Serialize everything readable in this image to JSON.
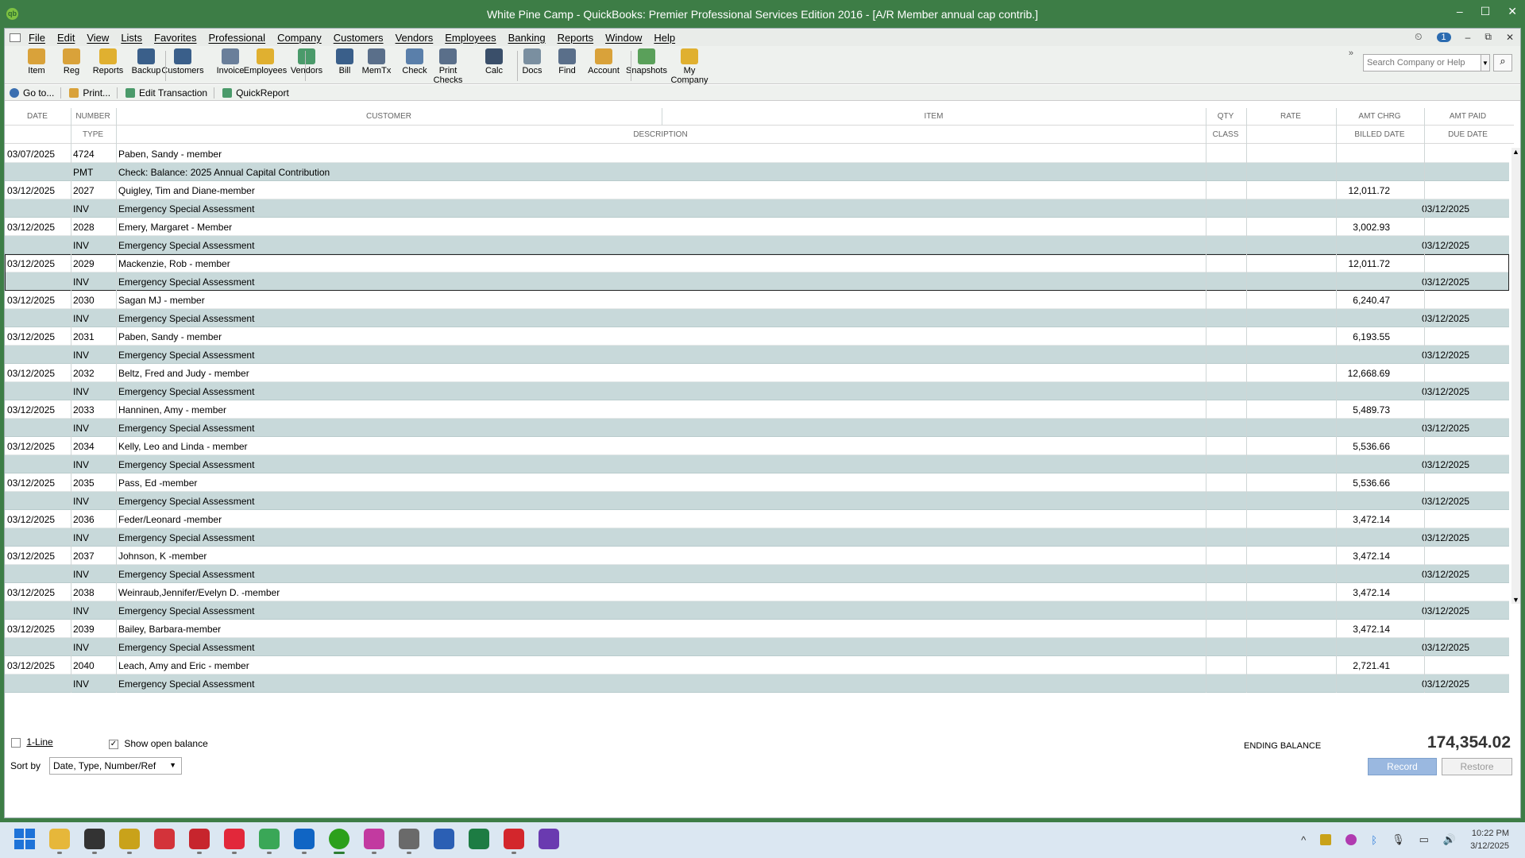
{
  "window": {
    "title": "White Pine Camp  - QuickBooks: Premier Professional Services Edition 2016 - [A/R Member annual cap contrib.]",
    "app_icon": "qb",
    "controls": [
      "–",
      "☐",
      "✕"
    ]
  },
  "menu": {
    "items": [
      "File",
      "Edit",
      "View",
      "Lists",
      "Favorites",
      "Professional",
      "Company",
      "Customers",
      "Vendors",
      "Employees",
      "Banking",
      "Reports",
      "Window",
      "Help"
    ],
    "reminder_count": "1",
    "child_controls": [
      "–",
      "⧉",
      "✕"
    ]
  },
  "toolbar": {
    "buttons": [
      {
        "label": "Item",
        "icon": "item-icon",
        "color": "#d9a23a"
      },
      {
        "label": "Reg",
        "icon": "register-icon",
        "color": "#d9a23a"
      },
      {
        "label": "Reports",
        "icon": "reports-icon",
        "color": "#e0b030"
      },
      {
        "label": "Backup",
        "icon": "backup-icon",
        "color": "#3a5f8a"
      },
      {
        "label": "Customers",
        "icon": "customers-icon",
        "color": "#3a5f8a"
      },
      {
        "label": "Invoice",
        "icon": "invoice-icon",
        "color": "#6a7f9a"
      },
      {
        "label": "Employees",
        "icon": "employees-icon",
        "color": "#e0b030"
      },
      {
        "label": "Vendors",
        "icon": "vendors-icon",
        "color": "#4a9a6a"
      },
      {
        "label": "Bill",
        "icon": "bill-icon",
        "color": "#3a5f8a"
      },
      {
        "label": "MemTx",
        "icon": "memtx-icon",
        "color": "#5a6f8a"
      },
      {
        "label": "Check",
        "icon": "check-icon",
        "color": "#5a7faa"
      },
      {
        "label": "Print Checks",
        "icon": "print-checks-icon",
        "color": "#5a6f8a"
      },
      {
        "label": "Calc",
        "icon": "calculator-icon",
        "color": "#3a4f6a"
      },
      {
        "label": "Docs",
        "icon": "docs-icon",
        "color": "#7a8fa0"
      },
      {
        "label": "Find",
        "icon": "find-icon",
        "color": "#5a6f8a"
      },
      {
        "label": "Account",
        "icon": "account-icon",
        "color": "#d9a23a"
      },
      {
        "label": "Snapshots",
        "icon": "snapshots-icon",
        "color": "#5aa05a"
      },
      {
        "label": "My Company",
        "icon": "my-company-icon",
        "color": "#e0b030"
      }
    ],
    "search_placeholder": "Search Company or Help",
    "more": "»"
  },
  "actions": [
    {
      "label": "Go to...",
      "icon": "goto-icon",
      "color": "#3a6fb0"
    },
    {
      "label": "Print...",
      "icon": "print-icon",
      "color": "#d9a23a"
    },
    {
      "label": "Edit Transaction",
      "icon": "edit-transaction-icon",
      "color": "#4a9a6a"
    },
    {
      "label": "QuickReport",
      "icon": "quickreport-icon",
      "color": "#4a9a6a"
    }
  ],
  "columns": {
    "line1": [
      "DATE",
      "NUMBER",
      "CUSTOMER",
      "ITEM",
      "QTY",
      "RATE",
      "AMT CHRG",
      "AMT PAID"
    ],
    "line2": [
      "TYPE",
      "DESCRIPTION",
      "CLASS",
      "BILLED DATE",
      "DUE DATE"
    ]
  },
  "transactions": [
    {
      "date": "03/07/2025",
      "number": "4724",
      "customer": "Paben, Sandy - member",
      "amt_chrg": "",
      "type": "PMT",
      "description": "Check: Balance: 2025 Annual Capital Contribution",
      "due_date": ""
    },
    {
      "date": "03/12/2025",
      "number": "2027",
      "customer": "Quigley, Tim and Diane-member",
      "amt_chrg": "12,011.72",
      "type": "INV",
      "description": "Emergency Special Assessment",
      "due_date": "03/12/2025"
    },
    {
      "date": "03/12/2025",
      "number": "2028",
      "customer": "Emery, Margaret - Member",
      "amt_chrg": "3,002.93",
      "type": "INV",
      "description": "Emergency Special Assessment",
      "due_date": "03/12/2025"
    },
    {
      "date": "03/12/2025",
      "number": "2029",
      "customer": "Mackenzie, Rob - member",
      "amt_chrg": "12,011.72",
      "type": "INV",
      "description": "Emergency Special Assessment",
      "due_date": "03/12/2025"
    },
    {
      "date": "03/12/2025",
      "number": "2030",
      "customer": "Sagan MJ - member",
      "amt_chrg": "6,240.47",
      "type": "INV",
      "description": "Emergency Special Assessment",
      "due_date": "03/12/2025"
    },
    {
      "date": "03/12/2025",
      "number": "2031",
      "customer": "Paben, Sandy - member",
      "amt_chrg": "6,193.55",
      "type": "INV",
      "description": "Emergency Special Assessment",
      "due_date": "03/12/2025"
    },
    {
      "date": "03/12/2025",
      "number": "2032",
      "customer": "Beltz, Fred and Judy - member",
      "amt_chrg": "12,668.69",
      "type": "INV",
      "description": "Emergency Special Assessment",
      "due_date": "03/12/2025"
    },
    {
      "date": "03/12/2025",
      "number": "2033",
      "customer": "Hanninen, Amy - member",
      "amt_chrg": "5,489.73",
      "type": "INV",
      "description": "Emergency Special Assessment",
      "due_date": "03/12/2025"
    },
    {
      "date": "03/12/2025",
      "number": "2034",
      "customer": "Kelly, Leo and Linda - member",
      "amt_chrg": "5,536.66",
      "type": "INV",
      "description": "Emergency Special Assessment",
      "due_date": "03/12/2025"
    },
    {
      "date": "03/12/2025",
      "number": "2035",
      "customer": "Pass, Ed -member",
      "amt_chrg": "5,536.66",
      "type": "INV",
      "description": "Emergency Special Assessment",
      "due_date": "03/12/2025"
    },
    {
      "date": "03/12/2025",
      "number": "2036",
      "customer": "Feder/Leonard -member",
      "amt_chrg": "3,472.14",
      "type": "INV",
      "description": "Emergency Special Assessment",
      "due_date": "03/12/2025"
    },
    {
      "date": "03/12/2025",
      "number": "2037",
      "customer": "Johnson, K -member",
      "amt_chrg": "3,472.14",
      "type": "INV",
      "description": "Emergency Special Assessment",
      "due_date": "03/12/2025"
    },
    {
      "date": "03/12/2025",
      "number": "2038",
      "customer": "Weinraub,Jennifer/Evelyn D. -member",
      "amt_chrg": "3,472.14",
      "type": "INV",
      "description": "Emergency Special Assessment",
      "due_date": "03/12/2025"
    },
    {
      "date": "03/12/2025",
      "number": "2039",
      "customer": "Bailey, Barbara-member",
      "amt_chrg": "3,472.14",
      "type": "INV",
      "description": "Emergency Special Assessment",
      "due_date": "03/12/2025"
    },
    {
      "date": "03/12/2025",
      "number": "2040",
      "customer": "Leach, Amy and Eric - member",
      "amt_chrg": "2,721.41",
      "type": "INV",
      "description": "Emergency Special Assessment",
      "due_date": "03/12/2025"
    }
  ],
  "selected_transaction": 3,
  "footer": {
    "one_line_label": "1-Line",
    "one_line_checked": false,
    "show_open_balance_label": "Show open balance",
    "show_open_balance_checked": true,
    "sort_by_label": "Sort by",
    "sort_by_value": "Date, Type, Number/Ref",
    "ending_balance_label": "ENDING BALANCE",
    "ending_balance": "174,354.02",
    "record_label": "Record",
    "restore_label": "Restore"
  },
  "taskbar": {
    "apps": [
      {
        "name": "start",
        "color": "#1e73d8"
      },
      {
        "name": "file-explorer",
        "color": "#e6b73a"
      },
      {
        "name": "app-c",
        "color": "#333333"
      },
      {
        "name": "app-notebook",
        "color": "#c9a21a"
      },
      {
        "name": "app-stack",
        "color": "#d3333a"
      },
      {
        "name": "app-s",
        "color": "#c7252d"
      },
      {
        "name": "vivaldi",
        "color": "#e2283a"
      },
      {
        "name": "chrome",
        "color": "#3aa757"
      },
      {
        "name": "outlook",
        "color": "#1065c4"
      },
      {
        "name": "quickbooks",
        "color": "#2ca01c"
      },
      {
        "name": "app-snip",
        "color": "#c23aa0"
      },
      {
        "name": "app-printer",
        "color": "#6a6a6a"
      },
      {
        "name": "word",
        "color": "#2b5fb4"
      },
      {
        "name": "excel",
        "color": "#1d7c43"
      },
      {
        "name": "acrobat",
        "color": "#d3262c"
      },
      {
        "name": "app-q",
        "color": "#6a3ab0"
      }
    ],
    "time": "10:22 PM",
    "date": "3/12/2025",
    "tray_chevron": "^"
  }
}
